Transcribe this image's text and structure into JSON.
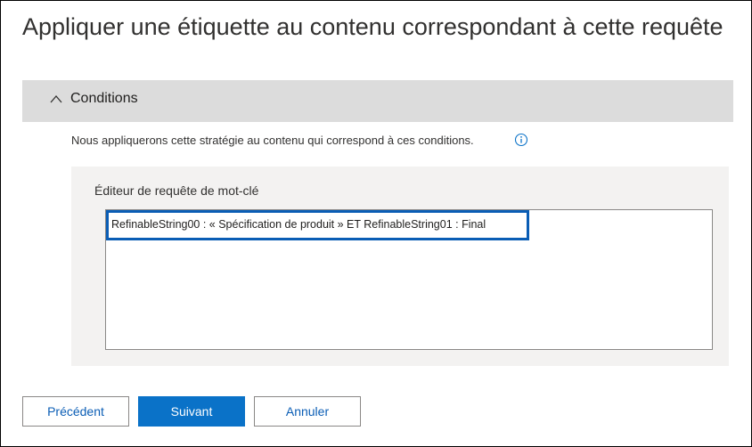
{
  "page": {
    "title": "Appliquer une étiquette au contenu correspondant à cette requête"
  },
  "conditions": {
    "label": "Conditions",
    "expanded": true,
    "toggle_icon": "chevron-up-icon",
    "description": "Nous appliquerons cette stratégie au contenu qui correspond à ces conditions.",
    "info_icon": "info-icon"
  },
  "editor": {
    "label": "Éditeur de requête de mot-clé",
    "query": "RefinableString00 : « Spécification de produit » ET RefinableString01 : Final"
  },
  "footer": {
    "previous_label": "Précédent",
    "next_label": "Suivant",
    "cancel_label": "Annuler"
  },
  "colors": {
    "accent": "#0a72c8",
    "highlight_border": "#0a5db5",
    "section_header_bg": "#dcdcdc",
    "panel_bg": "#f3f2f1"
  }
}
